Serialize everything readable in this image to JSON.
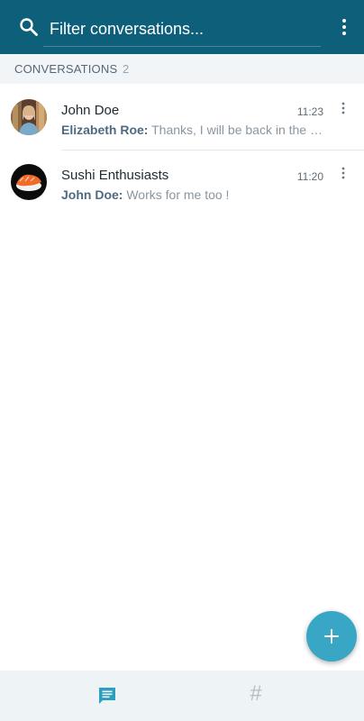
{
  "search": {
    "placeholder": "Filter conversations..."
  },
  "section": {
    "title": "CONVERSATIONS",
    "count": "2"
  },
  "conversations": [
    {
      "name": "John Doe",
      "time": "11:23",
      "sender": "Elizabeth Roe:",
      "message": "Thanks, I will be back in the office"
    },
    {
      "name": "Sushi Enthusiasts",
      "time": "11:20",
      "sender": "John Doe:",
      "message": "Works for me too !"
    }
  ],
  "colors": {
    "appbar": "#0e5f7a",
    "accent": "#3aa6c6",
    "sender": "#4e6a82"
  },
  "icons": {
    "search": "search-icon",
    "overflow": "more-vertical-icon",
    "compose": "plus-icon",
    "tab_conversations": "chat-bubble-icon",
    "tab_channels": "hash-icon"
  },
  "bottom_tabs": {
    "channels_glyph": "#"
  }
}
